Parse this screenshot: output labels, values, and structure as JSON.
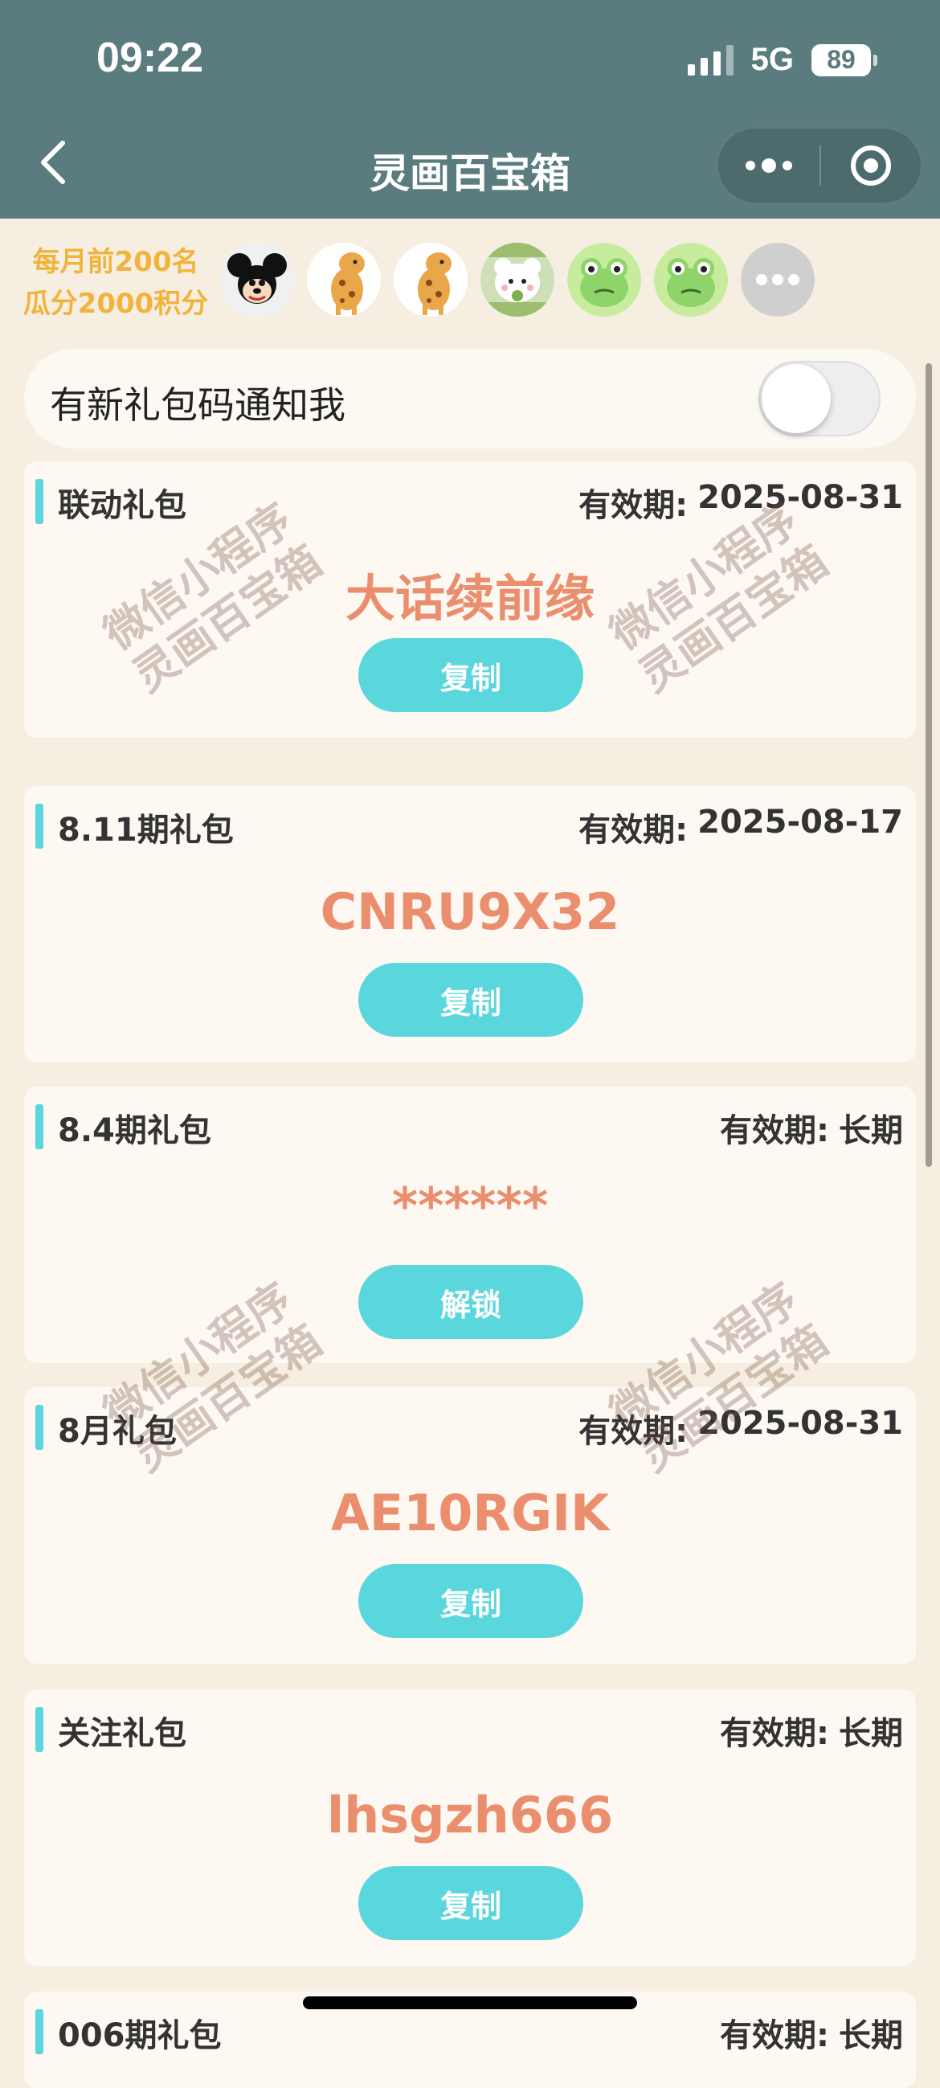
{
  "status_bar": {
    "time": "09:22",
    "network": "5G",
    "battery": "89"
  },
  "nav": {
    "title": "灵画百宝箱"
  },
  "ranking": {
    "line1": "每月前200名",
    "line2": "瓜分2000积分"
  },
  "notify": {
    "label": "有新礼包码通知我",
    "enabled": false
  },
  "watermark": {
    "line1": "微信小程序",
    "line2": "灵画百宝箱"
  },
  "gifts": [
    {
      "title": "联动礼包",
      "expire_label": "有效期:",
      "expire_value": "2025-08-31",
      "code": "大话续前缘",
      "button": "复制"
    },
    {
      "title": "8.11期礼包",
      "expire_label": "有效期:",
      "expire_value": "2025-08-17",
      "code": "CNRU9X32",
      "button": "复制"
    },
    {
      "title": "8.4期礼包",
      "expire_label": "有效期:",
      "expire_value": "长期",
      "code": "******",
      "button": "解锁"
    },
    {
      "title": "8月礼包",
      "expire_label": "有效期:",
      "expire_value": "2025-08-31",
      "code": "AE10RGIK",
      "button": "复制"
    },
    {
      "title": "关注礼包",
      "expire_label": "有效期:",
      "expire_value": "长期",
      "code": "lhsgzh666",
      "button": "复制"
    },
    {
      "title": "006期礼包",
      "expire_label": "有效期:",
      "expire_value": "长期",
      "code": "",
      "button": ""
    }
  ],
  "colors": {
    "header": "#5b7c7f",
    "accent": "#5ad7dc",
    "code": "#ea8e6d",
    "ranking": "#f2b33c",
    "background": "#f6efe1"
  },
  "icons": {
    "back": "chevron-left-icon",
    "more": "more-dots-icon",
    "close": "target-circle-icon",
    "avatars": [
      "mickey-avatar",
      "giraffe-avatar",
      "giraffe-avatar",
      "bear-avatar",
      "frog-avatar",
      "frog-avatar",
      "more-avatars-icon"
    ]
  }
}
